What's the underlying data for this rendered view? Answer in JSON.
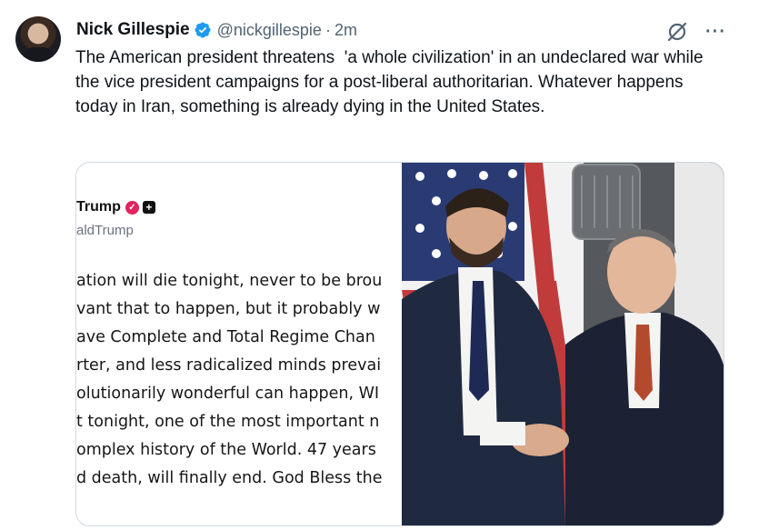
{
  "tweet": {
    "display_name": "Nick Gillespie",
    "handle": "@nickgillespie",
    "separator": "·",
    "time": "2m",
    "text": "The American president threatens  'a whole civilization' in an undeclared war while the vice president campaigns for a post-liberal authoritarian. Whatever happens today in Iran, something is already dying in the United States.",
    "more_label": "···"
  },
  "colors": {
    "verified_blue": "#1d9bf0",
    "text": "#0f1419",
    "secondary": "#536471",
    "border": "#cfd9de"
  },
  "icons": [
    "verified-badge-icon",
    "grok-icon",
    "more-icon"
  ],
  "media": {
    "screenshot": {
      "name": "Trump",
      "plus_label": "+",
      "handle": "aldTrump",
      "lines": [
        "ation will die tonight, never to be brou",
        "vant that to happen, but it probably w",
        "ave Complete and Total Regime Chan",
        "rter, and less radicalized minds prevai",
        "olutionarily wonderful can happen, WI",
        "t tonight, one of the most important n",
        "omplex history of the World. 47 years",
        "d death, will finally end. God Bless the"
      ]
    }
  }
}
